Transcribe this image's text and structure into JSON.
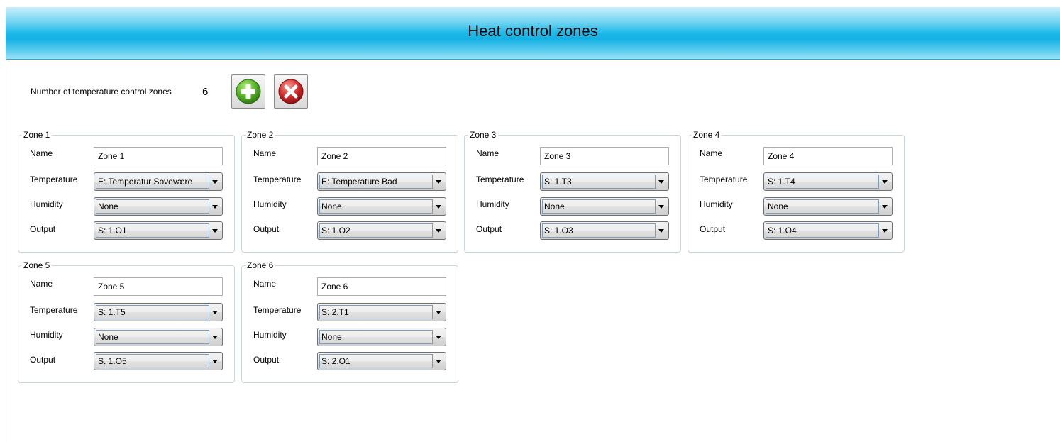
{
  "header": {
    "title": "Heat control zones"
  },
  "zone_count": {
    "label": "Number of temperature control zones",
    "value": "6"
  },
  "colors": {
    "header_accent": "#1cb9e8",
    "add_button": "#5cb82c",
    "remove_button": "#d8302f"
  },
  "icons": {
    "add": "plus-circle-icon",
    "remove": "x-circle-icon"
  },
  "labels": {
    "name": "Name",
    "temperature": "Temperature",
    "humidity": "Humidity",
    "output": "Output"
  },
  "zones": [
    {
      "title": "Zone 1",
      "name": "Zone 1",
      "temperature": "E: Temperatur Sovevære",
      "humidity": "None",
      "output": "S: 1.O1"
    },
    {
      "title": "Zone 2",
      "name": "Zone 2",
      "temperature": "E: Temperature Bad",
      "humidity": "None",
      "output": "S: 1.O2"
    },
    {
      "title": "Zone 3",
      "name": "Zone 3",
      "temperature": "S: 1.T3",
      "humidity": "None",
      "output": "S: 1.O3"
    },
    {
      "title": "Zone 4",
      "name": "Zone 4",
      "temperature": "S: 1.T4",
      "humidity": "None",
      "output": "S: 1.O4"
    },
    {
      "title": "Zone 5",
      "name": "Zone 5",
      "temperature": "S: 1.T5",
      "humidity": "None",
      "output": "S. 1.O5"
    },
    {
      "title": "Zone 6",
      "name": "Zone 6",
      "temperature": "S: 2.T1",
      "humidity": "None",
      "output": "S: 2.O1"
    }
  ]
}
